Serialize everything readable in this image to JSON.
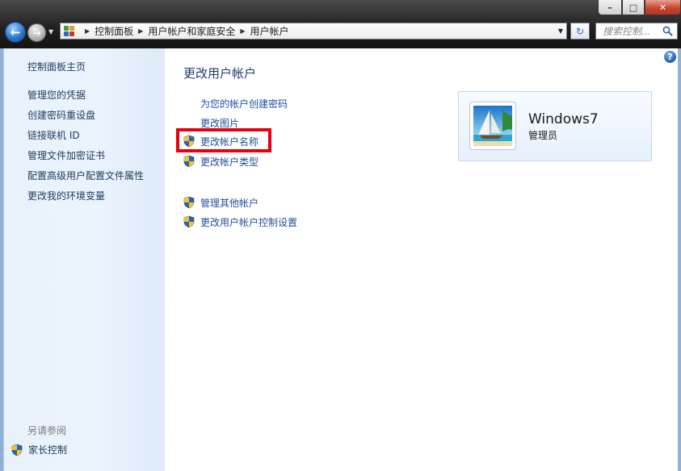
{
  "window": {
    "caption_min": "–",
    "caption_max": "□",
    "caption_close": "✕"
  },
  "nav": {
    "back_glyph": "←",
    "forward_glyph": "→",
    "history_glyph": "▼",
    "refresh_glyph": "↻",
    "breadcrumb": [
      "控制面板",
      "用户帐户和家庭安全",
      "用户帐户"
    ],
    "search_placeholder": "搜索控制..."
  },
  "left_pane": {
    "home": "控制面板主页",
    "links": [
      "管理您的凭据",
      "创建密码重设盘",
      "链接联机 ID",
      "管理文件加密证书",
      "配置高级用户配置文件属性",
      "更改我的环境变量"
    ],
    "see_also": "另请参阅",
    "family_safety": "家长控制"
  },
  "main": {
    "help_glyph": "?",
    "title": "更改用户帐户",
    "tasks": [
      {
        "label": "为您的帐户创建密码",
        "shield": false
      },
      {
        "label": "更改图片",
        "shield": false
      },
      {
        "label": "更改帐户名称",
        "shield": true
      },
      {
        "label": "更改帐户类型",
        "shield": true
      }
    ],
    "other_tasks": [
      {
        "label": "管理其他帐户",
        "shield": true
      },
      {
        "label": "更改用户帐户控制设置",
        "shield": true
      }
    ],
    "account": {
      "name": "Windows7",
      "role": "管理员"
    }
  },
  "colors": {
    "link": "#1f4e9c",
    "title": "#1e3c6e",
    "highlight": "#e8000f"
  }
}
